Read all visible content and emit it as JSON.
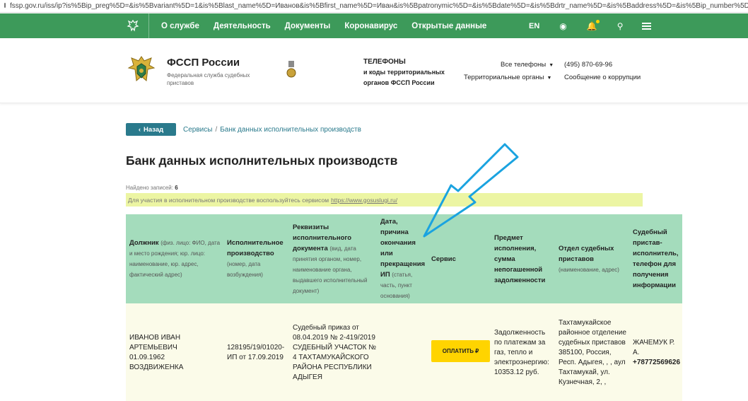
{
  "browser": {
    "url": "fssp.gov.ru/iss/ip?is%5Bip_preg%5D=&is%5Bvariant%5D=1&is%5Blast_name%5D=Иванов&is%5Bfirst_name%5D=Иван&is%5Bpatronymic%5D=&is%5Bdate%5D=&is%5Bdrtr_name%5D=&is%5Baddress%5D=&is%5Bip_number%5D=&is%5Bid_number%5..."
  },
  "topnav": {
    "items": [
      "О службе",
      "Деятельность",
      "Документы",
      "Коронавирус",
      "Открытые данные"
    ],
    "lang": "EN"
  },
  "header": {
    "org_title": "ФССП России",
    "org_subtitle": "Федеральная служба судебных приставов",
    "phones_heading": [
      "ТЕЛЕФОНЫ",
      "и коды территориальных",
      "органов ФССП России"
    ],
    "all_phones": "Все телефоны",
    "territorial": "Территориальные органы",
    "phone": "(495) 870-69-96",
    "corruption": "Сообщение о коррупции"
  },
  "breadcrumb": {
    "back": "Назад",
    "services": "Сервисы",
    "current": "Банк данных исполнительных производств"
  },
  "page": {
    "title": "Банк данных исполнительных производств",
    "found_label": "Найдено записей:",
    "found_count": "6",
    "notice_text": "Для участия в исполнительном производстве воспользуйтесь сервисом",
    "notice_link": "https://www.gosuslugi.ru/"
  },
  "table": {
    "headers": [
      {
        "title": "Должник",
        "note": "(физ. лицо: ФИО, дата и место рождения; юр. лицо: наименование, юр. адрес, фактический адрес)"
      },
      {
        "title": "Исполнительное производство",
        "note": "(номер, дата возбуждения)"
      },
      {
        "title": "Реквизиты исполнительного документа",
        "note": "(вид, дата принятия органом, номер, наименование органа, выдавшего исполнительный документ)"
      },
      {
        "title": "Дата, причина окончания или прекращения ИП",
        "note": "(статья, часть, пункт основания)"
      },
      {
        "title": "Сервис",
        "note": ""
      },
      {
        "title": "Предмет исполнения, сумма непогашенной задолженности",
        "note": ""
      },
      {
        "title": "Отдел судебных приставов",
        "note": "(наименование, адрес)"
      },
      {
        "title": "Судебный пристав-исполнитель, телефон для получения информации",
        "note": ""
      }
    ],
    "row": {
      "debtor": "ИВАНОВ ИВАН АРТЕМЬЕВИЧ 01.09.1962 ВОЗДВИЖЕНКА",
      "proceeding": "128195/19/01020-ИП от 17.09.2019",
      "document": "Судебный приказ от 08.04.2019 № 2-419/2019 СУДЕБНЫЙ УЧАСТОК № 4 ТАХТАМУКАЙСКОГО РАЙОНА РЕСПУБЛИКИ АДЫГЕЯ",
      "end_date": "",
      "pay_button": "ОПЛАТИТЬ ₽",
      "subject": "Задолженность по платежам за газ, тепло и электроэнергию: 10353.12 руб.",
      "department": "Тахтамукайское районное отделение судебных приставов 385100, Россия, Респ. Адыгея, , , аул Тахтамукай, ул. Кузнечная, 2, ,",
      "bailiff_name": "ЖАЧЕМУК Р. А.",
      "bailiff_phone": "+78772569626"
    }
  },
  "colors": {
    "nav_green": "#3d9a5a",
    "header_row": "#a4dcbc",
    "body_row": "#fbfbe9",
    "notice": "#ecf5a3",
    "pay_yellow": "#ffd400",
    "link_teal": "#2a7a8c",
    "arrow_blue": "#1aa3e0"
  }
}
